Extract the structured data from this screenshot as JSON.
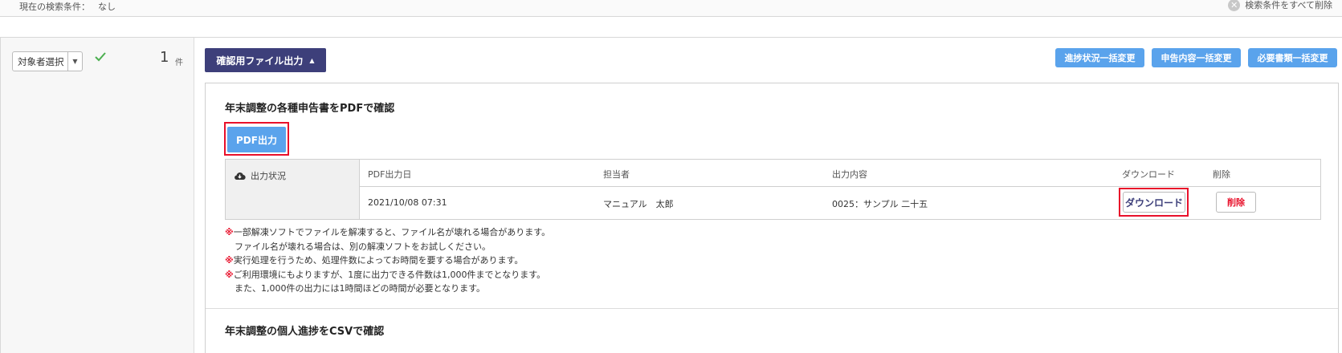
{
  "search": {
    "label": "現在の検索条件：",
    "value": "なし",
    "clear_all": "検索条件をすべて削除"
  },
  "left": {
    "target_select": "対象者選択",
    "count": "1",
    "count_unit": "件"
  },
  "toolbar": {
    "confirm_file_output": "確認用ファイル出力",
    "bulk_progress": "進捗状況一括変更",
    "bulk_declaration": "申告内容一括変更",
    "bulk_documents": "必要書類一括変更"
  },
  "pdf_section": {
    "title": "年末調整の各種申告書をPDFで確認",
    "pdf_button": "PDF出力",
    "status_label": "出力状況",
    "columns": {
      "date": "PDF出力日",
      "person": "担当者",
      "content": "出力内容",
      "download": "ダウンロード",
      "delete": "削除"
    },
    "row": {
      "date": "2021/10/08 07:31",
      "person": "マニュアル　太郎",
      "content": "0025：サンプル 二十五",
      "download": "ダウンロード",
      "delete": "削除"
    },
    "notes": [
      {
        "mark": "※",
        "text": "一部解凍ソフトでファイルを解凍すると、ファイル名が壊れる場合があります。"
      },
      {
        "mark": "",
        "text": "ファイル名が壊れる場合は、別の解凍ソフトをお試しください。"
      },
      {
        "mark": "※",
        "text": "実行処理を行うため、処理件数によってお時間を要する場合があります。"
      },
      {
        "mark": "※",
        "text": "ご利用環境にもよりますが、1度に出力できる件数は1,000件までとなります。"
      },
      {
        "mark": "",
        "text": "また、1,000件の出力には1時間ほどの時間が必要となります。"
      }
    ]
  },
  "csv_section": {
    "title": "年末調整の個人進捗をCSVで確認"
  },
  "colors": {
    "navy": "#3d3f7a",
    "blue": "#5aa3ec",
    "highlight_red": "#e8102a",
    "check_green": "#4caf50"
  },
  "icons": {
    "check": "check-icon",
    "cloud": "cloud-download-icon",
    "clear": "clear-circle-icon",
    "caret": "caret-up-icon",
    "dropdown": "chevron-down-icon"
  }
}
